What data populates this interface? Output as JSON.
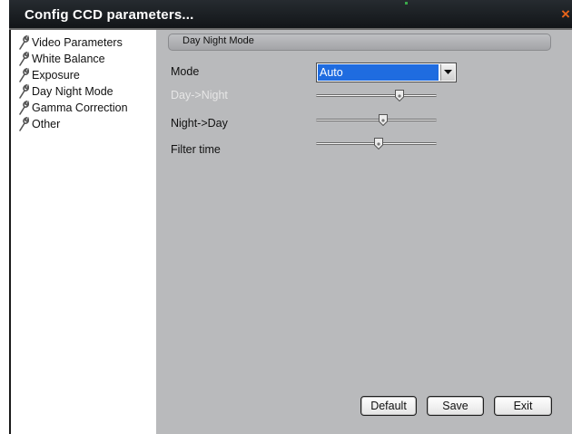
{
  "window": {
    "title": "Config CCD parameters...",
    "close_label": "×"
  },
  "sidebar": {
    "items": [
      {
        "label": "Video Parameters"
      },
      {
        "label": "White Balance"
      },
      {
        "label": "Exposure"
      },
      {
        "label": "Day Night Mode"
      },
      {
        "label": "Gamma Correction"
      },
      {
        "label": "Other"
      }
    ]
  },
  "panel": {
    "section_title": "Day Night Mode",
    "mode": {
      "label": "Mode",
      "value": "Auto"
    },
    "sliders": [
      {
        "label": "Day->Night",
        "value": 0.69,
        "enabled": false
      },
      {
        "label": "Night->Day",
        "value": 0.56,
        "enabled": true
      },
      {
        "label": "Filter time",
        "value": 0.52,
        "enabled": true
      }
    ]
  },
  "buttons": {
    "default": "Default",
    "save": "Save",
    "exit": "Exit"
  },
  "colors": {
    "titlebar": "#1b1f23",
    "panel": "#b9babc",
    "selection": "#1f6ce0",
    "close": "#e8641a"
  }
}
